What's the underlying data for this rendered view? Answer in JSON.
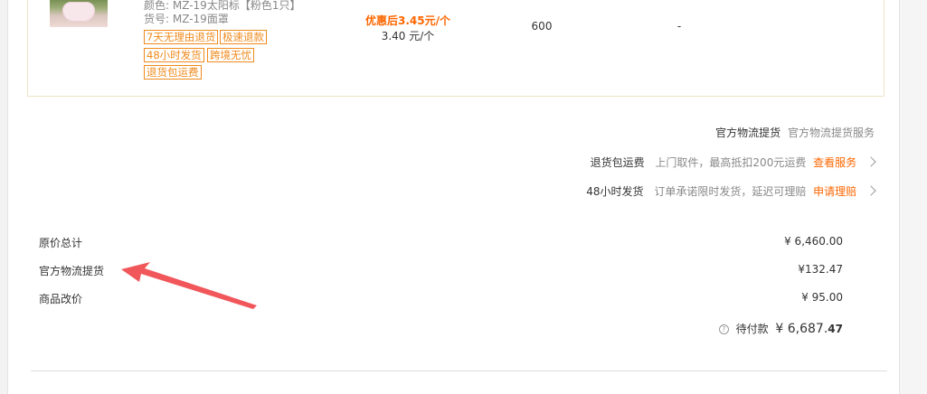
{
  "product": {
    "image_alt": "product-thumbnail",
    "color_line": "颜色: MZ-19太阳标【粉色1只】",
    "sku_line": "货号: MZ-19面罩",
    "tags": [
      "7天无理由退货",
      "极速退款",
      "48小时发货",
      "跨境无忧",
      "退货包运费"
    ],
    "promo_price": "优惠后3.45元/个",
    "unit_price": "3.40 元/个",
    "quantity": "600",
    "discount": "-"
  },
  "services": [
    {
      "name": "官方物流提货",
      "desc": "官方物流提货服务",
      "link": ""
    },
    {
      "name": "退货包运费",
      "desc": "上门取件，最高抵扣200元运费",
      "link": "查看服务"
    },
    {
      "name": "48小时发货",
      "desc": "订单承诺限时发货，延迟可理赔",
      "link": "申请理赔"
    }
  ],
  "totals": [
    {
      "label": "原价总计",
      "value": "¥ 6,460.00"
    },
    {
      "label": "官方物流提货",
      "value": "¥132.47"
    },
    {
      "label": "商品改价",
      "value": "¥ 95.00"
    }
  ],
  "pending": {
    "label": "待付款",
    "amount_int": "¥ 6,687.",
    "amount_dec": "47"
  },
  "colors": {
    "accent": "#ff6600",
    "tag_border": "#f08a1c",
    "annotation_arrow": "#f0565a"
  }
}
